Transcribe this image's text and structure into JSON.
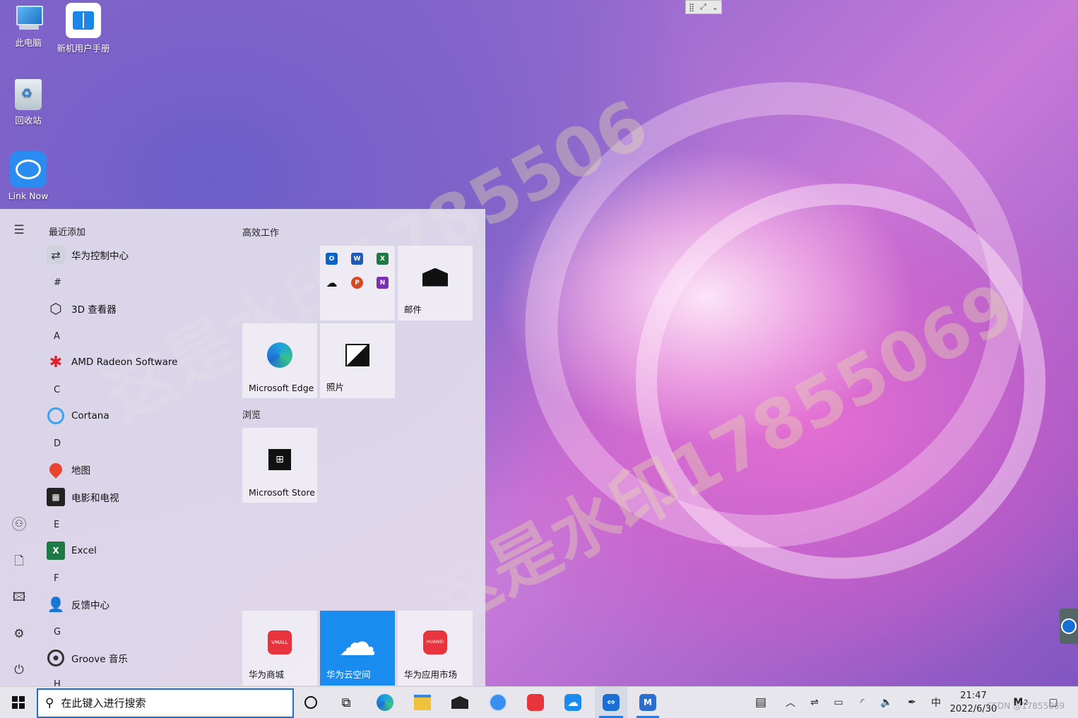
{
  "desktop": {
    "icons": [
      {
        "label": "此电脑",
        "icon": "computer-icon"
      },
      {
        "label": "新机用户手册",
        "icon": "manual-icon"
      },
      {
        "label": "回收站",
        "icon": "recycle-bin-icon"
      },
      {
        "label": "Link Now",
        "icon": "link-now-icon"
      }
    ],
    "watermark": "这是水印1785506",
    "watermark2": "这是水印17855069"
  },
  "start_menu": {
    "recent_header": "最近添加",
    "apps": [
      {
        "label": "华为控制中心",
        "icon": "huawei-control-icon"
      },
      {
        "letter": "#"
      },
      {
        "label": "3D 查看器",
        "icon": "3d-viewer-icon"
      },
      {
        "letter": "A"
      },
      {
        "label": "AMD Radeon Software",
        "icon": "amd-radeon-icon"
      },
      {
        "letter": "C"
      },
      {
        "label": "Cortana",
        "icon": "cortana-icon"
      },
      {
        "letter": "D"
      },
      {
        "label": "地图",
        "icon": "maps-icon"
      },
      {
        "label": "电影和电视",
        "icon": "movies-icon"
      },
      {
        "letter": "E"
      },
      {
        "label": "Excel",
        "icon": "excel-icon"
      },
      {
        "letter": "F"
      },
      {
        "label": "反馈中心",
        "icon": "feedback-icon"
      },
      {
        "letter": "G"
      },
      {
        "label": "Groove 音乐",
        "icon": "groove-icon"
      },
      {
        "letter": "H"
      }
    ],
    "groups": {
      "productivity": "高效工作",
      "browse": "浏览"
    },
    "tiles": {
      "mail": "邮件",
      "edge": "Microsoft Edge",
      "photos": "照片",
      "store": "Microsoft Store",
      "vmall": "华为商城",
      "cloud": "华为云空间",
      "appgallery": "华为应用市场"
    },
    "office_minis": [
      "O",
      "W",
      "X",
      "",
      "P",
      "N"
    ]
  },
  "taskbar": {
    "search_placeholder": "在此键入进行搜索",
    "ime": "中",
    "time": "21:47",
    "date": "2022/6/30",
    "notification_count": "2",
    "watermark_text": "CSDN @17855069"
  },
  "colors": {
    "accent": "#1a8cf0",
    "taskbar_bg": "#e6e6ec",
    "start_bg": "#e2deec"
  }
}
